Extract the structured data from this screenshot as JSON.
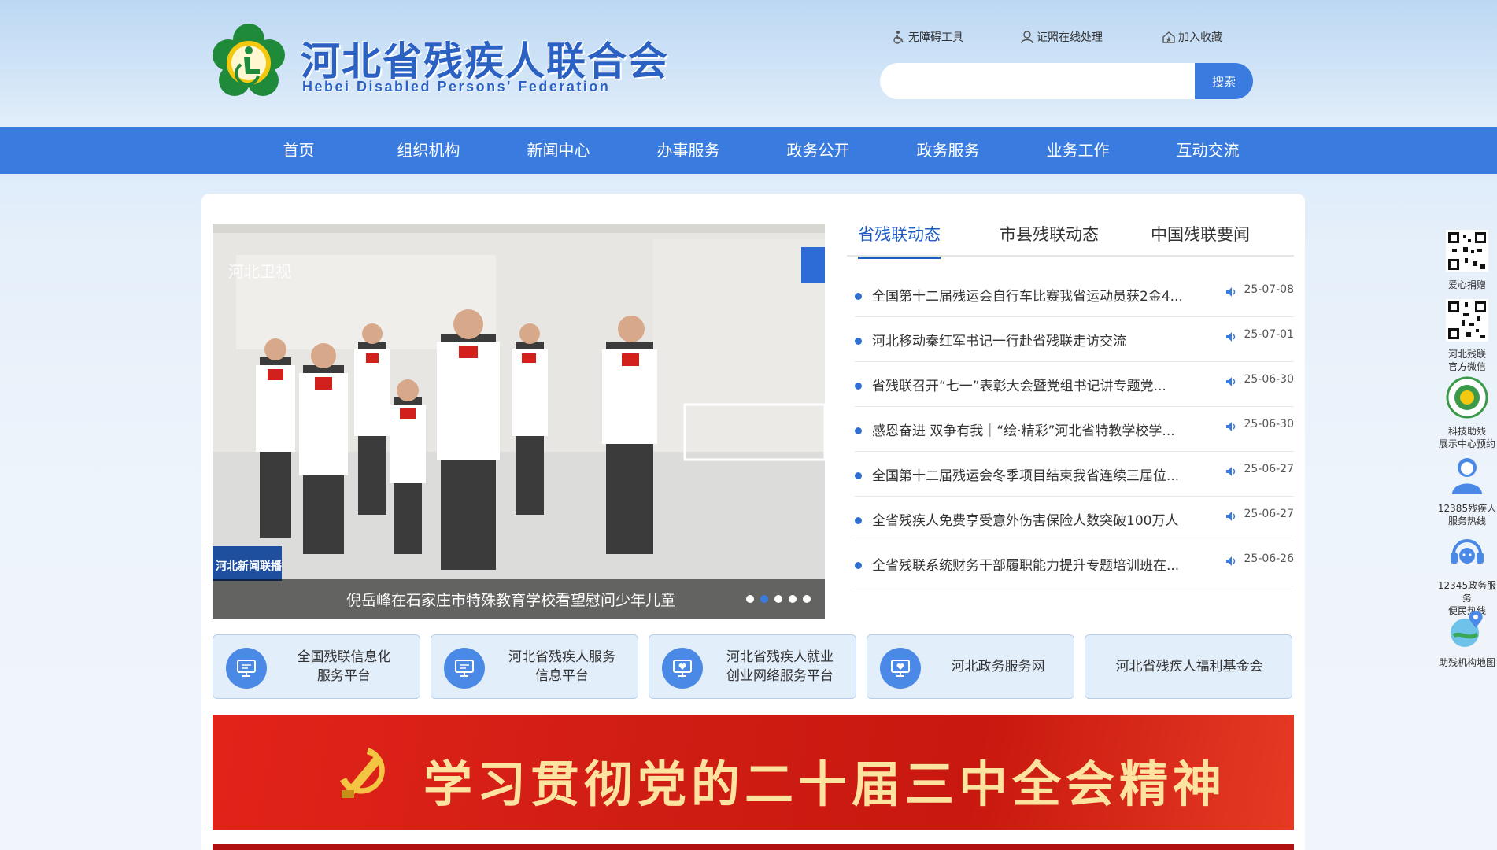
{
  "header": {
    "title": "河北省残疾人联合会",
    "subtitle": "Hebei Disabled Persons' Federation",
    "tools": [
      {
        "label": "无障碍工具",
        "icon": "accessibility-icon"
      },
      {
        "label": "证照在线处理",
        "icon": "user-icon"
      },
      {
        "label": "加入收藏",
        "icon": "home-star-icon"
      }
    ],
    "search": {
      "placeholder": "",
      "button": "搜索"
    }
  },
  "nav": {
    "items": [
      "首页",
      "组织机构",
      "新闻中心",
      "办事服务",
      "政务公开",
      "政务服务",
      "业务工作",
      "互动交流"
    ]
  },
  "slider": {
    "caption": "倪岳峰在石家庄市特殊教育学校看望慰问少年儿童",
    "dots": 5,
    "active_dot": 1,
    "watermark": "河北卫视",
    "program_badge": "河北新闻联播"
  },
  "news": {
    "tabs": [
      "省残联动态",
      "市县残联动态",
      "中国残联要闻"
    ],
    "active_tab": 0,
    "items": [
      {
        "title": "全国第十二届残运会自行车比赛我省运动员获2金4...",
        "date": "25-07-08"
      },
      {
        "title": "河北移动秦红军书记一行赴省残联走访交流",
        "date": "25-07-01"
      },
      {
        "title": "省残联召开“七一”表彰大会暨党组书记讲专题党...",
        "date": "25-06-30"
      },
      {
        "title": "感恩奋进 双争有我｜“绘·精彩”河北省特教学校学...",
        "date": "25-06-30"
      },
      {
        "title": "全国第十二届残运会冬季项目结束我省连续三届位...",
        "date": "25-06-27"
      },
      {
        "title": "全省残疾人免费享受意外伤害保险人数突破100万人",
        "date": "25-06-27"
      },
      {
        "title": "全省残联系统财务干部履职能力提升专题培训班在...",
        "date": "25-06-26"
      }
    ]
  },
  "platforms": [
    {
      "line1": "全国残联信息化",
      "line2": "服务平台",
      "icon": "monitor-icon"
    },
    {
      "line1": "河北省残疾人服务",
      "line2": "信息平台",
      "icon": "monitor-icon"
    },
    {
      "line1": "河北省残疾人就业",
      "line2": "创业网络服务平台",
      "icon": "heart-monitor-icon"
    },
    {
      "line1": "河北政务服务网",
      "line2": "",
      "icon": "heart-monitor-icon"
    },
    {
      "line1": "河北省残疾人福利基金会",
      "line2": "",
      "icon": ""
    }
  ],
  "banner": {
    "text": "学习贯彻党的二十届三中全会精神"
  },
  "side": [
    {
      "label1": "爱心捐赠",
      "label2": "",
      "icon": "qr-code-icon"
    },
    {
      "label1": "河北残联",
      "label2": "官方微信",
      "icon": "qr-code-icon"
    },
    {
      "label1": "科技助残",
      "label2": "展示中心预约",
      "icon": "badge-icon"
    },
    {
      "label1": "12385残疾人",
      "label2": "服务热线",
      "icon": "service-person-icon"
    },
    {
      "label1": "12345政务服务",
      "label2": "便民热线",
      "icon": "headset-icon"
    },
    {
      "label1": "助残机构地图",
      "label2": "",
      "icon": "map-pin-icon"
    }
  ],
  "colors": {
    "primary": "#3a7be0",
    "link": "#1e5cc4",
    "banner": "#d01d14"
  }
}
